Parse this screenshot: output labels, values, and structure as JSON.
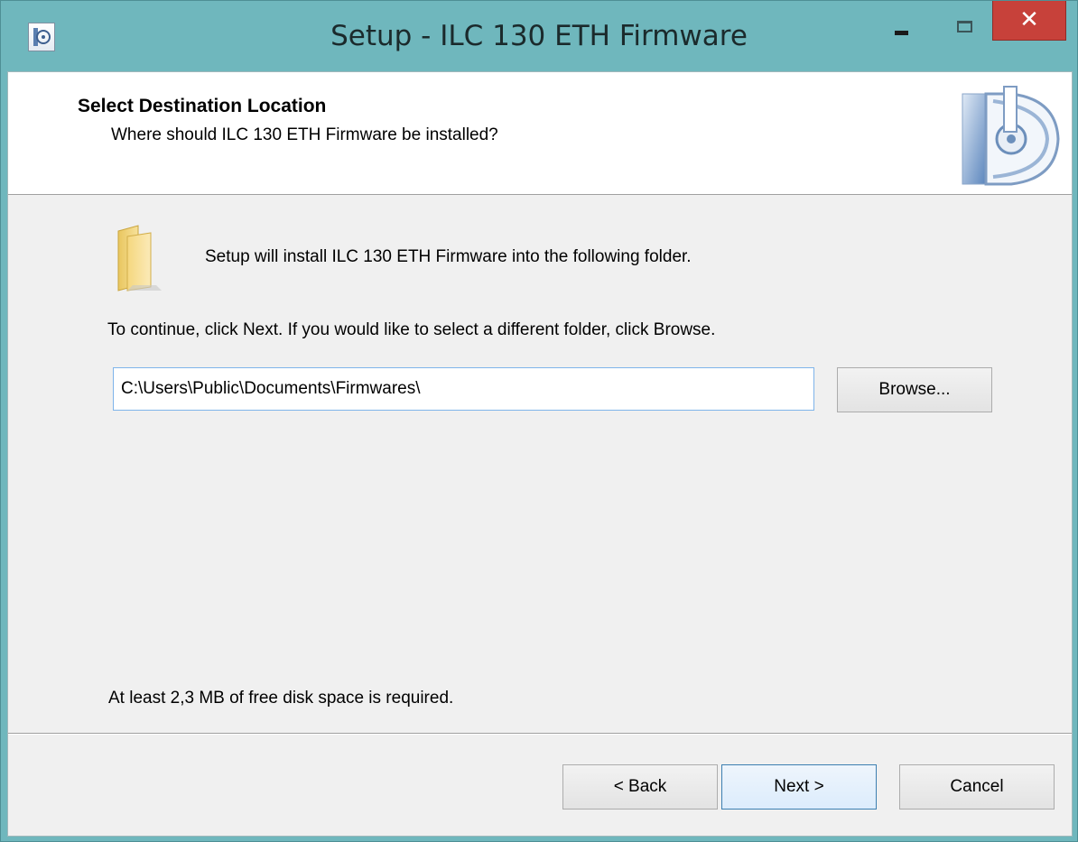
{
  "window": {
    "title": "Setup - ILC 130 ETH Firmware",
    "icons": {
      "app": "setup-icon",
      "minimize": "minimize-icon",
      "maximize": "maximize-icon",
      "close": "close-icon"
    },
    "close_glyph": "✕"
  },
  "header": {
    "title": "Select Destination Location",
    "subtitle": "Where should ILC 130 ETH Firmware be installed?",
    "logo_icon": "setup-disc-logo-icon"
  },
  "body": {
    "folder_icon": "folder-icon",
    "intro": "Setup will install ILC 130 ETH Firmware into the following folder.",
    "instruction": "To continue, click Next. If you would like to select a different folder, click Browse.",
    "path_value": "C:\\Users\\Public\\Documents\\Firmwares\\",
    "browse_label": "Browse...",
    "disk_space": "At least 2,3 MB of free disk space is required."
  },
  "footer": {
    "back_label": "< Back",
    "next_label": "Next >",
    "cancel_label": "Cancel"
  },
  "colors": {
    "titlebar": "#6fb7bd",
    "close_button": "#c7413a",
    "focus_border": "#3c7fb1"
  }
}
